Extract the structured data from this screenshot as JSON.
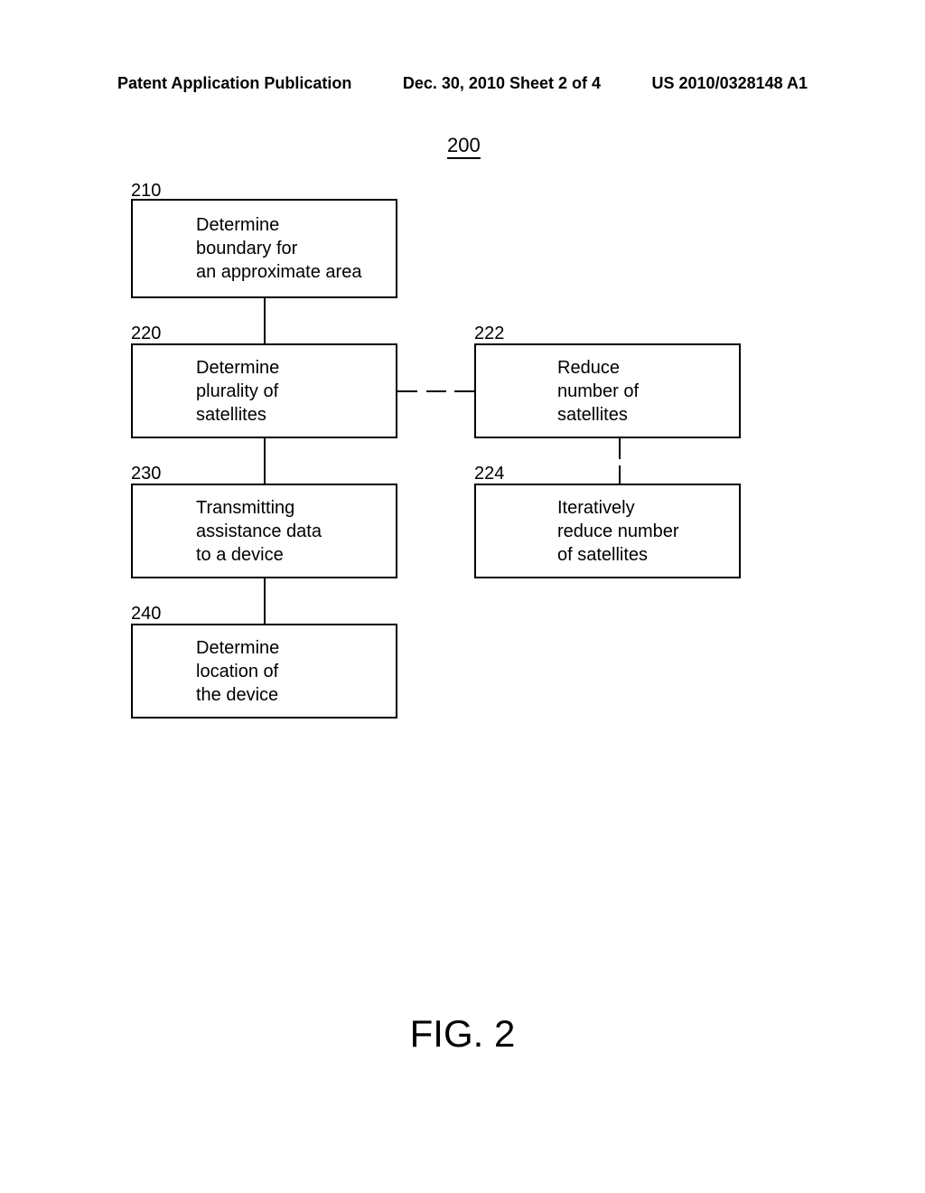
{
  "header": {
    "left": "Patent Application Publication",
    "center": "Dec. 30, 2010  Sheet 2 of 4",
    "right": "US 2010/0328148 A1"
  },
  "figure_number": "200",
  "labels": {
    "b210": "210",
    "b220": "220",
    "b222": "222",
    "b224": "224",
    "b230": "230",
    "b240": "240"
  },
  "boxes": {
    "b210": "Determine\nboundary for\nan approximate area",
    "b220": "Determine\nplurality of\nsatellites",
    "b222": "Reduce\nnumber of\nsatellites",
    "b224": "Iteratively\nreduce number\nof satellites",
    "b230": "Transmitting\nassistance data\nto a device",
    "b240": "Determine\nlocation of\nthe device"
  },
  "caption": "FIG. 2"
}
